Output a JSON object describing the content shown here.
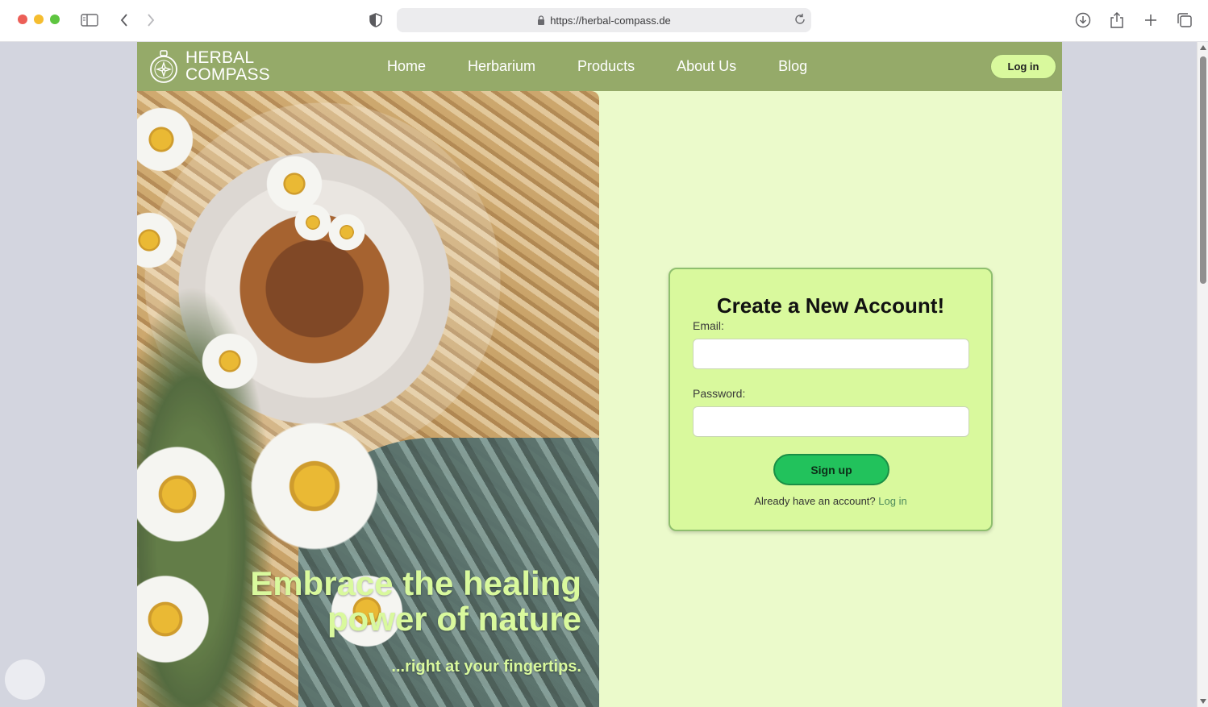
{
  "browser": {
    "url": "https://herbal-compass.de"
  },
  "site": {
    "logo_line1": "HERBAL",
    "logo_line2": "COMPASS",
    "nav": {
      "home": "Home",
      "herbarium": "Herbarium",
      "products": "Products",
      "about": "About Us",
      "blog": "Blog"
    },
    "login_label": "Log in"
  },
  "hero": {
    "title_line1": "Embrace the healing",
    "title_line2": "power of nature",
    "subtitle": "...right at your fingertips."
  },
  "signup": {
    "title": "Create a New Account!",
    "email_label": "Email:",
    "email_value": "",
    "password_label": "Password:",
    "password_value": "",
    "submit_label": "Sign up",
    "already_text": "Already have an account?",
    "login_link": "Log in"
  },
  "colors": {
    "header_bg": "#95aa69",
    "page_bg": "#ebfacb",
    "card_bg": "#d9f99d",
    "accent_green": "#22c25c",
    "hero_text": "#d9f99d"
  },
  "icons": {
    "sidebar": "sidebar-icon",
    "back": "chevron-left-icon",
    "forward": "chevron-right-icon",
    "shield": "shield-icon",
    "lock": "lock-icon",
    "reload": "reload-icon",
    "download": "download-icon",
    "share": "share-icon",
    "new_tab": "plus-icon",
    "tabs": "tabs-icon",
    "logo": "compass-icon"
  }
}
